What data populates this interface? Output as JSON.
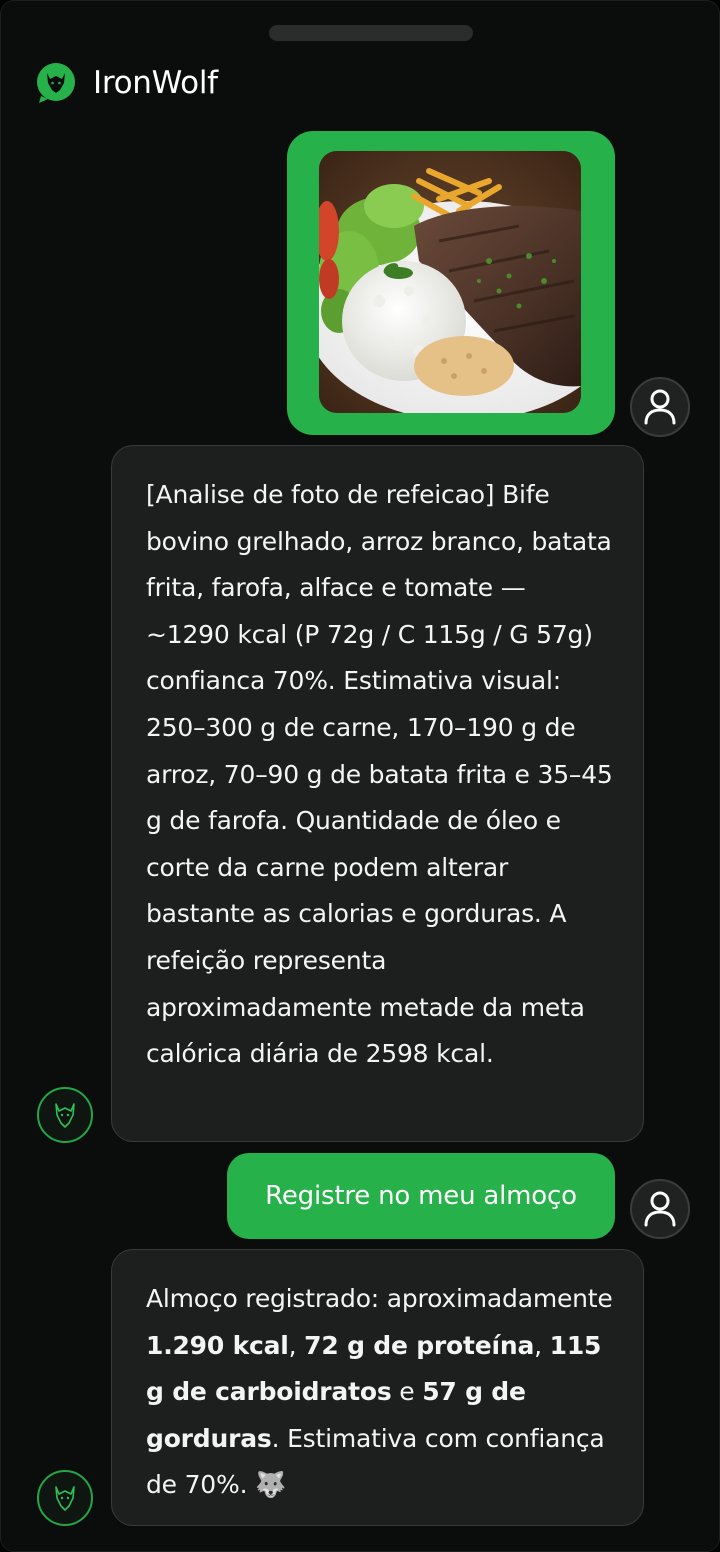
{
  "app": {
    "title": "IronWolf"
  },
  "messages": {
    "photo": {
      "image_alt": "Prato com bife bovino grelhado, arroz branco, batata frita, farofa, alface e tomate"
    },
    "analysis": {
      "text": "[Analise de foto de refeicao] Bife bovino grelhado, arroz branco, batata frita, farofa, alface e tomate — ~1290 kcal (P 72g / C 115g / G 57g) confianca 70%. Estimativa visual: 250–300 g de carne, 170–190 g de arroz, 70–90 g de batata frita e 35–45 g de farofa. Quantidade de óleo e corte da carne podem alterar bastante as calorias e gorduras. A refeição representa aproximadamente metade da meta calórica diária de 2598 kcal."
    },
    "user_request": {
      "text": "Registre no meu almoço"
    },
    "confirmation": {
      "prefix": "Almoço registrado: aproximadamente ",
      "calories": "1.290 kcal",
      "sep1": ", ",
      "protein": "72 g de proteína",
      "sep2": ", ",
      "carbs": "115 g de carboidratos",
      "sep3": " ",
      "and": "e",
      "sep4": " ",
      "fat": "57 g de gorduras",
      "suffix": ". Estimativa com confiança de 70%. ",
      "emoji": "🐺"
    }
  },
  "icons": {
    "logo": "wolf-chat-logo-icon",
    "user_avatar": "user-icon",
    "bot_avatar": "wolf-icon"
  },
  "colors": {
    "accent": "#27b14b",
    "background": "#0b0d0c",
    "bubble": "#1c1f1e"
  }
}
